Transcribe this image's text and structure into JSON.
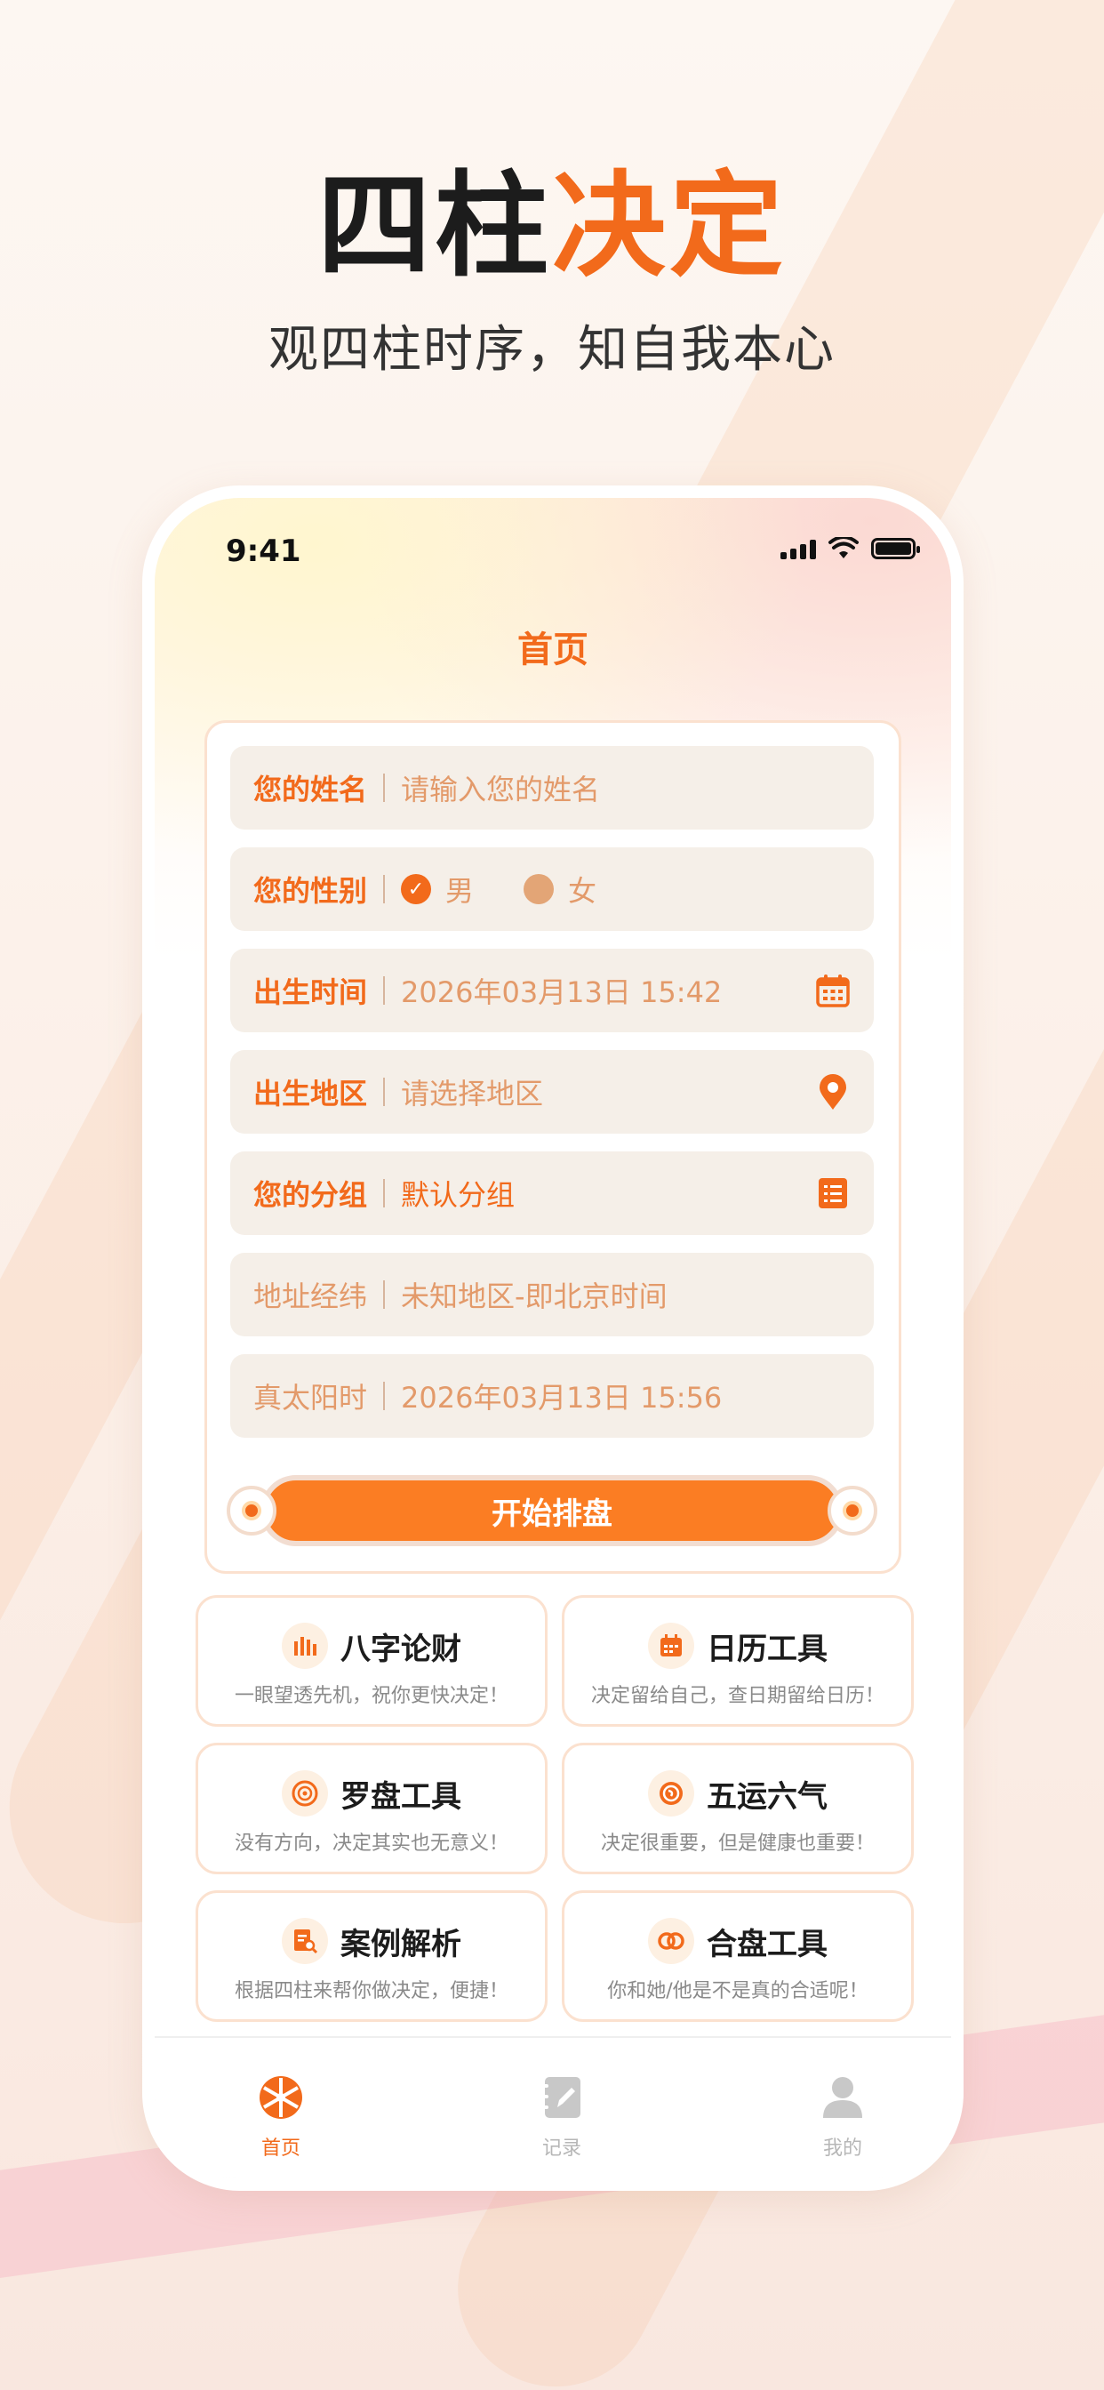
{
  "hero": {
    "title_main": "四柱",
    "title_accent": "决定",
    "subtitle": "观四柱时序，知自我本心"
  },
  "status_bar": {
    "time": "9:41"
  },
  "nav": {
    "title": "首页"
  },
  "form": {
    "name": {
      "label": "您的姓名",
      "placeholder": "请输入您的姓名"
    },
    "gender": {
      "label": "您的性别",
      "options": [
        "男",
        "女"
      ],
      "selected": "男"
    },
    "birth_time": {
      "label": "出生时间",
      "value": "2026年03月13日 15:42",
      "icon": "calendar-icon"
    },
    "birth_region": {
      "label": "出生地区",
      "placeholder": "请选择地区",
      "icon": "location-pin-icon"
    },
    "group": {
      "label": "您的分组",
      "value": "默认分组",
      "icon": "list-icon"
    },
    "address": {
      "label": "地址经纬",
      "value": "未知地区-即北京时间"
    },
    "solar_time": {
      "label": "真太阳时",
      "value": "2026年03月13日 15:56"
    },
    "submit_label": "开始排盘"
  },
  "tools": [
    {
      "name": "八字论财",
      "desc": "一眼望透先机，祝你更快决定！",
      "icon": "bar-chart-icon"
    },
    {
      "name": "日历工具",
      "desc": "决定留给自己，查日期留给日历！",
      "icon": "calendar-icon"
    },
    {
      "name": "罗盘工具",
      "desc": "没有方向，决定其实也无意义！",
      "icon": "compass-icon"
    },
    {
      "name": "五运六气",
      "desc": "决定很重要，但是健康也重要！",
      "icon": "cycle-icon"
    },
    {
      "name": "案例解析",
      "desc": "根据四柱来帮你做决定，便捷！",
      "icon": "document-search-icon"
    },
    {
      "name": "合盘工具",
      "desc": "你和她/他是不是真的合适呢！",
      "icon": "rings-icon"
    }
  ],
  "tabbar": {
    "items": [
      {
        "label": "首页",
        "icon": "wheel-icon",
        "active": true
      },
      {
        "label": "记录",
        "icon": "notebook-icon",
        "active": false
      },
      {
        "label": "我的",
        "icon": "user-icon",
        "active": false
      }
    ]
  },
  "colors": {
    "accent": "#f26a1b",
    "field_bg": "#f5efe8",
    "button": "#fb7d23"
  }
}
